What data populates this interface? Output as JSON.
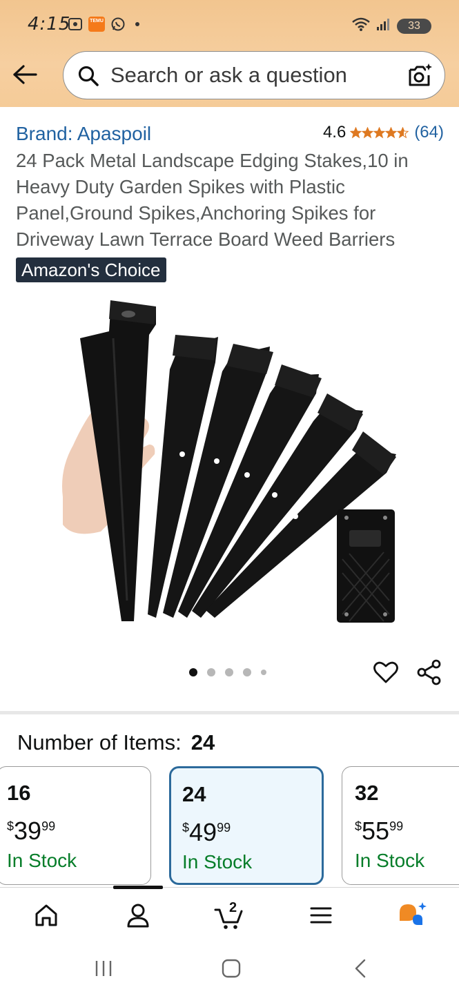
{
  "status_bar": {
    "time": "4:15",
    "temu_label": "TEMU",
    "battery": "33"
  },
  "search": {
    "placeholder": "Search or ask a question"
  },
  "product": {
    "brand": "Brand: Apaspoil",
    "rating_value": "4.6",
    "rating_stars": 4.6,
    "rating_count": "(64)",
    "title": "24 Pack Metal Landscape Edging Stakes,10 in Heavy Duty Garden Spikes with Plastic Panel,Ground Spikes,Anchoring Spikes for Driveway Lawn Terrace Board Weed Barriers",
    "badge": "Amazon's Choice",
    "image_count": 5,
    "active_image": 1
  },
  "variations": {
    "label": "Number of Items:",
    "selected_value": "24",
    "options": [
      {
        "count": "16",
        "currency": "$",
        "whole": "39",
        "fraction": "99",
        "stock": "In Stock",
        "selected": false
      },
      {
        "count": "24",
        "currency": "$",
        "whole": "49",
        "fraction": "99",
        "stock": "In Stock",
        "selected": true
      },
      {
        "count": "32",
        "currency": "$",
        "whole": "55",
        "fraction": "99",
        "stock": "In Stock",
        "selected": false
      }
    ]
  },
  "bottom_nav": {
    "items": [
      "home-icon",
      "account-icon",
      "cart-icon",
      "menu-icon",
      "rufus-icon"
    ],
    "active": "account-icon",
    "cart_count": "2"
  },
  "colors": {
    "header_bg": "#f6cb9a",
    "link": "#2162a1",
    "stock": "#067d29",
    "star": "#de7921",
    "badge_bg": "#232f3e",
    "selected_border": "#2c6a9b"
  }
}
